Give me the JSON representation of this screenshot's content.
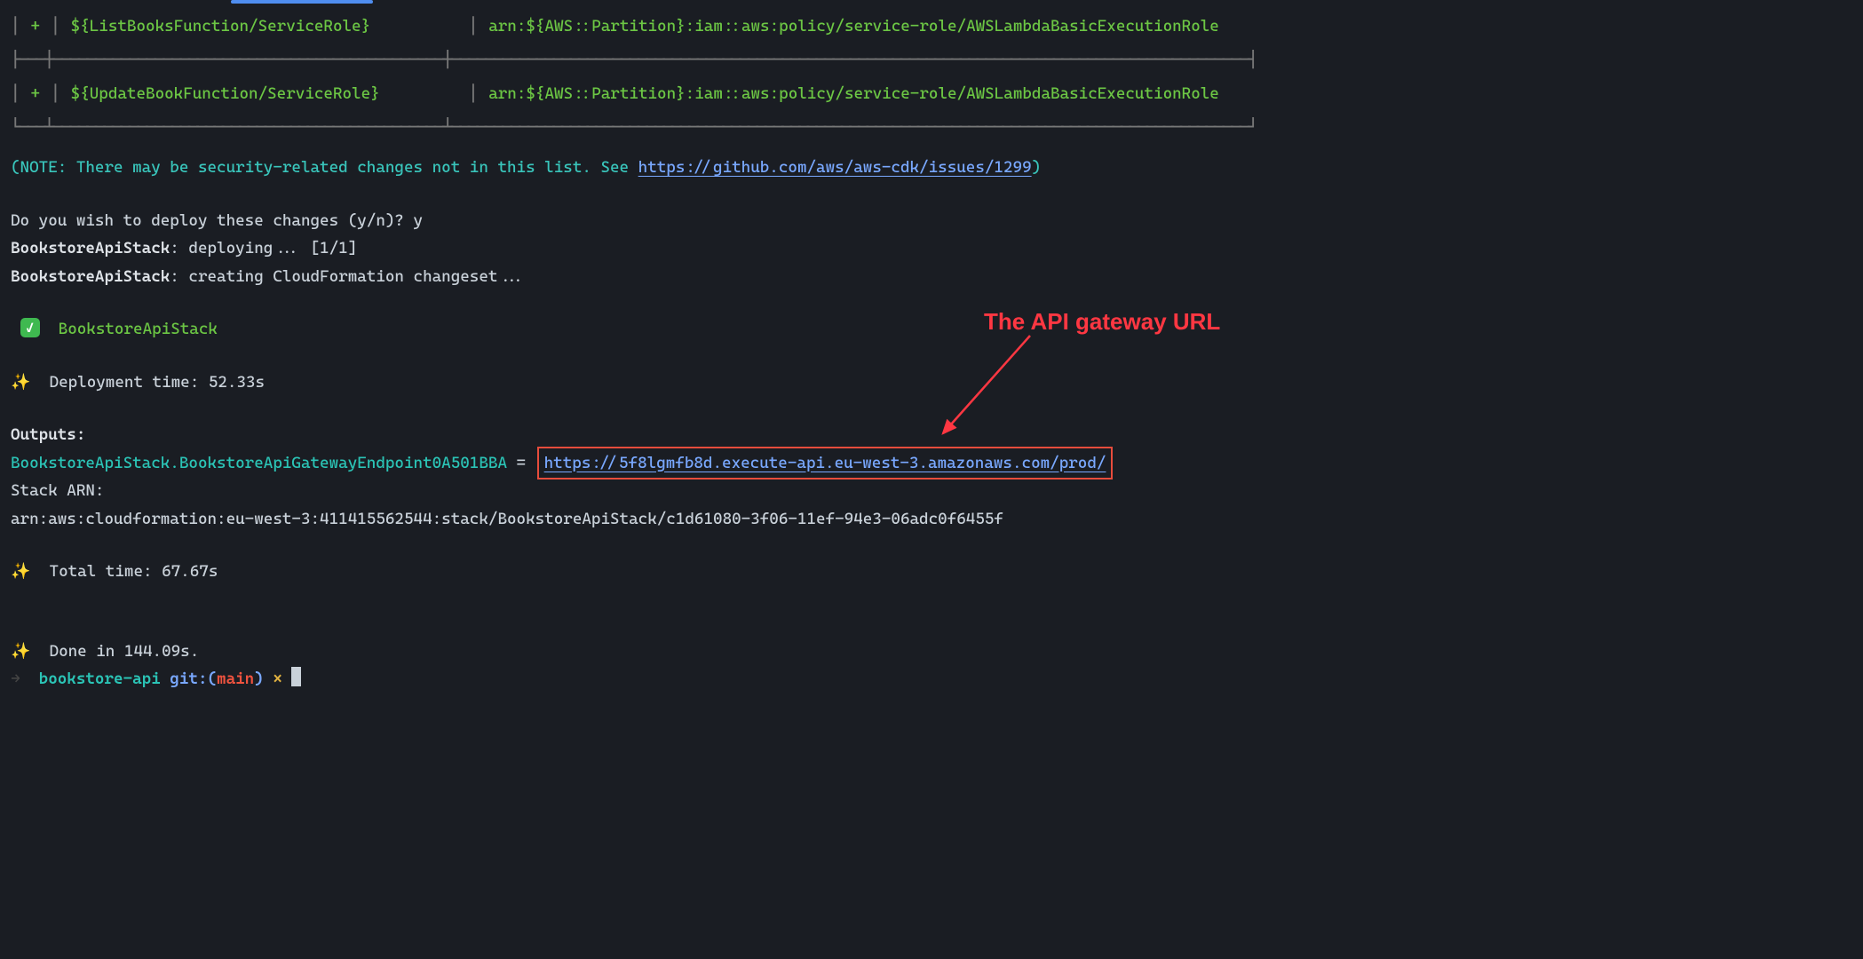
{
  "table": {
    "rows": [
      {
        "plus": "+",
        "resource": "${ListBooksFunction/ServiceRole}",
        "arn": "arn:${AWS::Partition}:iam::aws:policy/service-role/AWSLambdaBasicExecutionRole"
      },
      {
        "plus": "+",
        "resource": "${UpdateBookFunction/ServiceRole}",
        "arn": "arn:${AWS::Partition}:iam::aws:policy/service-role/AWSLambdaBasicExecutionRole"
      }
    ]
  },
  "note": {
    "prefix": "(NOTE: There may be security-related changes not in this list. See ",
    "link": "https://github.com/aws/aws-cdk/issues/1299",
    "suffix": ")"
  },
  "confirm": {
    "question": "Do you wish to deploy these changes (y/n)? ",
    "answer": "y"
  },
  "deploy": {
    "line1_prefix": "BookstoreApiStack",
    "line1_rest": ": deploying... [1/1]",
    "line2_prefix": "BookstoreApiStack",
    "line2_rest": ": creating CloudFormation changeset..."
  },
  "success": {
    "check": "✓",
    "stack": "BookstoreApiStack"
  },
  "times": {
    "sparkle": "✨",
    "deployment_label": "  Deployment time: ",
    "deployment_value": "52.33s",
    "total_label": "  Total time: ",
    "total_value": "67.67s",
    "done_label": "  Done in ",
    "done_value": "144.09s."
  },
  "outputs": {
    "header": "Outputs:",
    "endpoint_key": "BookstoreApiStack.BookstoreApiGatewayEndpoint0A501BBA",
    "equals": " = ",
    "endpoint_url": "https://5f8lgmfb8d.execute-api.eu-west-3.amazonaws.com/prod/",
    "stack_arn_label": "Stack ARN:",
    "stack_arn_value": "arn:aws:cloudformation:eu-west-3:411415562544:stack/BookstoreApiStack/c1d61080-3f06-11ef-94e3-06adc0f6455f"
  },
  "prompt": {
    "arrow": "→",
    "dir": "bookstore-api",
    "git_prefix": "git:(",
    "branch": "main",
    "git_suffix": ")",
    "dirty": "×"
  },
  "annotation": {
    "label": "The API gateway URL"
  }
}
